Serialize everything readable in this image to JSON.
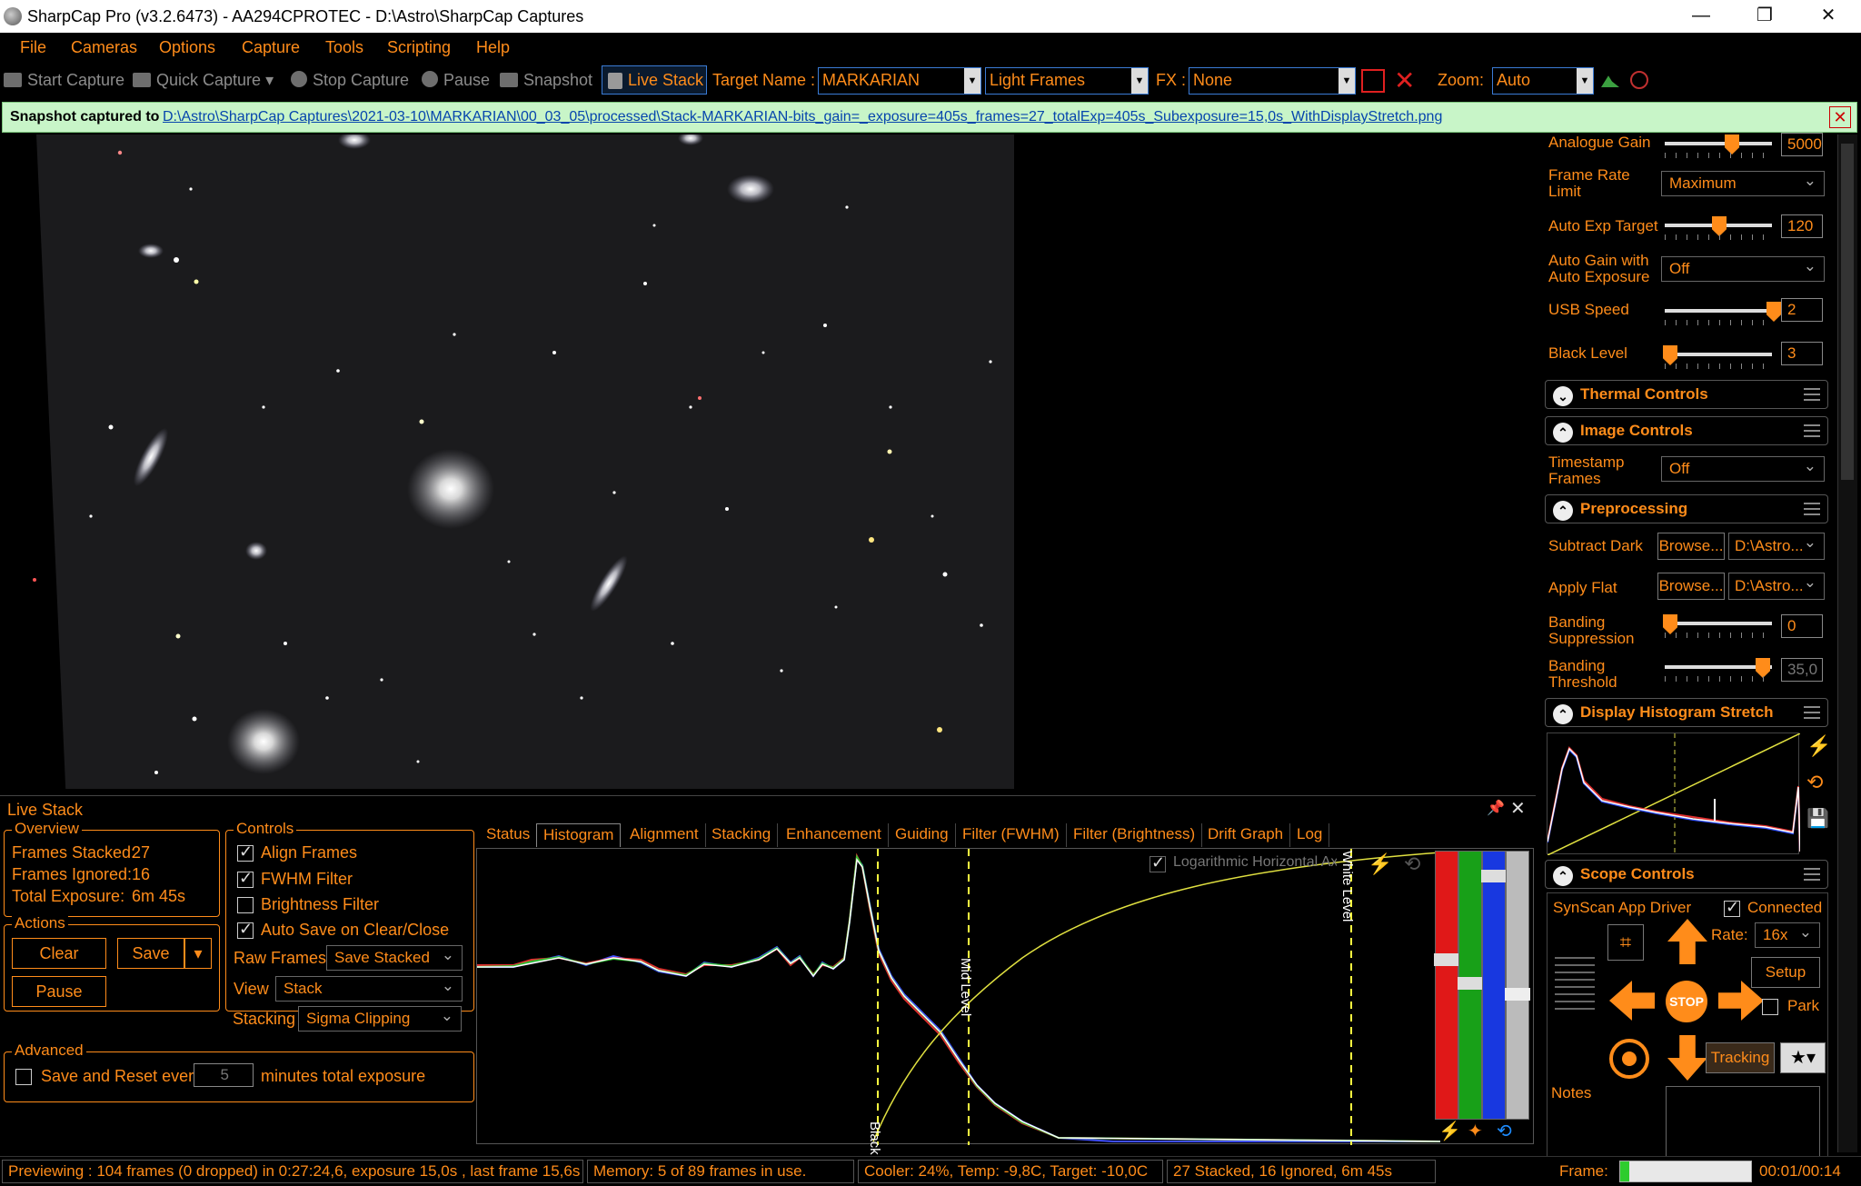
{
  "window": {
    "title": "SharpCap Pro (v3.2.6473) - AA294CPROTEC - D:\\Astro\\SharpCap Captures",
    "minimize": "—",
    "restore": "❐",
    "close": "✕"
  },
  "menu": [
    "File",
    "Cameras",
    "Options",
    "Capture",
    "Tools",
    "Scripting",
    "Help"
  ],
  "toolbar": {
    "start_capture": "Start Capture",
    "quick_capture": "Quick Capture",
    "stop_capture": "Stop Capture",
    "pause": "Pause",
    "snapshot": "Snapshot",
    "live_stack": "Live Stack",
    "target_name_label": "Target Name :",
    "target_name_value": "MARKARIAN",
    "frame_type": "Light Frames",
    "fx_label": "FX :",
    "fx_value": "None",
    "zoom_label": "Zoom:",
    "zoom_value": "Auto"
  },
  "notification": {
    "label": "Snapshot captured to",
    "path": "D:\\Astro\\SharpCap Captures\\2021-03-10\\MARKARIAN\\00_03_05\\processed\\Stack-MARKARIAN-bits_gain=_exposure=405s_frames=27_totalExp=405s_Subexposure=15,0s_WithDisplayStretch.png"
  },
  "live_stack": {
    "title": "Live Stack",
    "overview": {
      "title": "Overview",
      "frames_stacked_label": "Frames Stacked:",
      "frames_stacked": "27",
      "frames_ignored_label": "Frames Ignored:",
      "frames_ignored": "16",
      "total_exposure_label": "Total Exposure:",
      "total_exposure": "6m 45s"
    },
    "actions": {
      "title": "Actions",
      "clear": "Clear",
      "save": "Save",
      "pause": "Pause"
    },
    "controls": {
      "title": "Controls",
      "align_frames": "Align Frames",
      "fwhm_filter": "FWHM Filter",
      "brightness_filter": "Brightness Filter",
      "auto_save": "Auto Save on Clear/Close",
      "raw_frames_label": "Raw Frames",
      "raw_frames_value": "Save Stacked",
      "view_label": "View",
      "view_value": "Stack",
      "stacking_label": "Stacking",
      "stacking_value": "Sigma Clipping"
    },
    "advanced": {
      "title": "Advanced",
      "save_reset_label": "Save and Reset every",
      "minutes_value": "5",
      "minutes_label": "minutes total exposure"
    },
    "tabs": [
      "Status",
      "Histogram",
      "Alignment",
      "Stacking",
      "Enhancement",
      "Guiding",
      "Filter (FWHM)",
      "Filter (Brightness)",
      "Drift Graph",
      "Log"
    ],
    "histogram": {
      "log_axis_label": "Logarithmic Horizontal Axis",
      "black_level": "Black Level",
      "mid_level": "Mid Level",
      "white_level": "White Level"
    }
  },
  "camera_controls": {
    "analogue_gain_label": "Analogue Gain",
    "analogue_gain_value": "5000",
    "frame_rate_label": "Frame Rate Limit",
    "frame_rate_value": "Maximum",
    "auto_exp_target_label": "Auto Exp Target",
    "auto_exp_target_value": "120",
    "auto_gain_label": "Auto Gain with Auto Exposure",
    "auto_gain_value": "Off",
    "usb_speed_label": "USB Speed",
    "usb_speed_value": "2",
    "black_level_label": "Black Level",
    "black_level_value": "3"
  },
  "sections": {
    "thermal": "Thermal Controls",
    "image": "Image Controls",
    "preprocessing": "Preprocessing",
    "display_histogram": "Display Histogram Stretch",
    "scope": "Scope Controls"
  },
  "image_controls": {
    "timestamp_label": "Timestamp Frames",
    "timestamp_value": "Off"
  },
  "preprocessing": {
    "subtract_dark_label": "Subtract Dark",
    "browse": "Browse...",
    "dark_path": "D:\\Astro...",
    "apply_flat_label": "Apply Flat",
    "flat_path": "D:\\Astro...",
    "banding_suppression_label": "Banding Suppression",
    "banding_suppression_value": "0",
    "banding_threshold_label": "Banding Threshold",
    "banding_threshold_value": "35,0"
  },
  "scope": {
    "driver": "SynScan App Driver",
    "connected_label": "Connected",
    "rate_label": "Rate:",
    "rate_value": "16x",
    "setup": "Setup",
    "stop": "STOP",
    "park": "Park",
    "tracking": "Tracking",
    "notes_label": "Notes"
  },
  "status": {
    "previewing": "Previewing : 104 frames (0 dropped) in 0:27:24,6, exposure 15,0s , last frame 15,6s",
    "memory": "Memory: 5 of 89 frames in use.",
    "cooler": "Cooler: 24%, Temp: -9,8C, Target: -10,0C",
    "stacked": "27 Stacked, 16 Ignored, 6m 45s",
    "frame_label": "Frame:",
    "frame_time": "00:01/00:14",
    "frame_progress": 0.07
  },
  "colors": {
    "accent": "#ff8c1a",
    "background": "#000000",
    "notification_bg": "#c8f5c8",
    "link": "#0645ad"
  }
}
